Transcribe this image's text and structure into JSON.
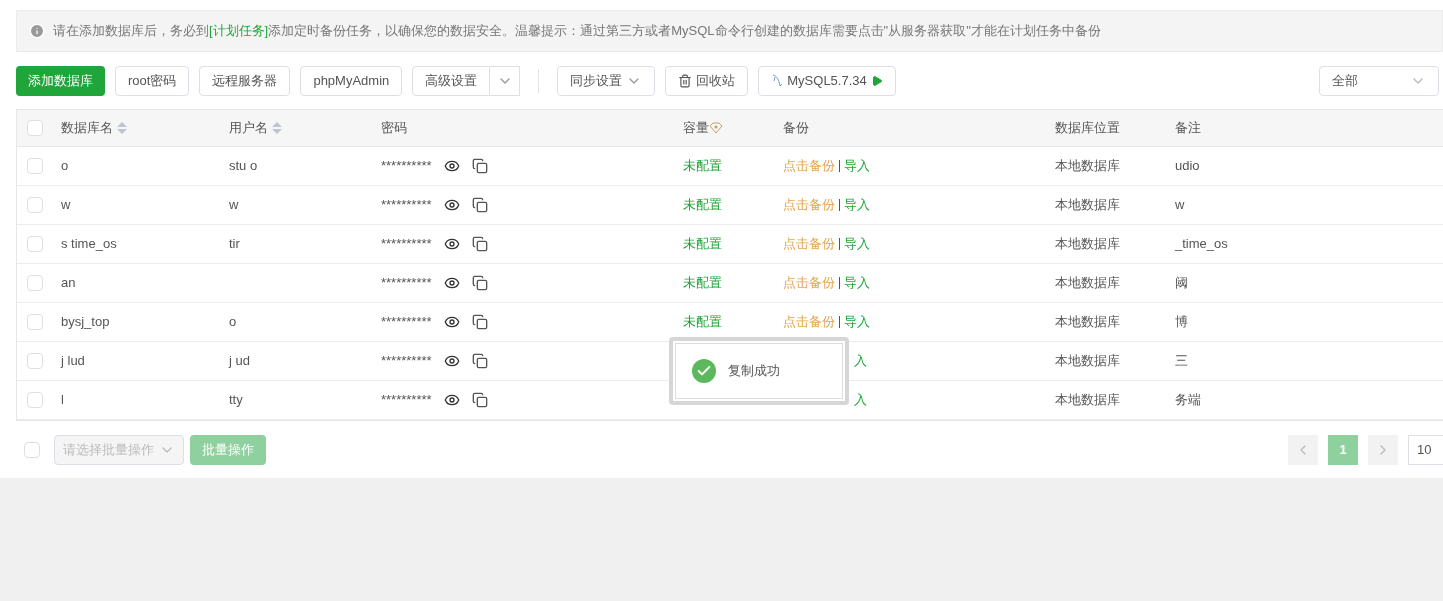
{
  "notice": {
    "text": "请在添加数据库后，务必到",
    "link": "[计划任务]",
    "rest": "添加定时备份任务，以确保您的数据安全。温馨提示：通过第三方或者MySQL命令行创建的数据库需要点击\"从服务器获取\"才能在计划任务中备份"
  },
  "toolbar": {
    "add": "添加数据库",
    "root": "root密码",
    "remote": "远程服务器",
    "pma": "phpMyAdmin",
    "advanced": "高级设置",
    "sync": "同步设置",
    "recycle": "回收站",
    "mysql": "MySQL5.7.34",
    "filter": "全部"
  },
  "table": {
    "all_checked": false,
    "columns": [
      {
        "label": "数据库名",
        "sortable": true
      },
      {
        "label": "用户名",
        "sortable": true
      },
      {
        "label": "密码",
        "sortable": false
      },
      {
        "label": "容量",
        "sortable": false
      },
      {
        "label": "备份",
        "sortable": false
      },
      {
        "label": "数据库位置",
        "sortable": false
      },
      {
        "label": "备注",
        "sortable": false
      }
    ],
    "rows": [
      {
        "checked": false,
        "name": "o",
        "user": "stu o",
        "password": "**********",
        "capacity": "未配置",
        "backup": "点击备份",
        "import": "导入",
        "location": "本地数据库",
        "note": "udio"
      },
      {
        "checked": false,
        "name": "w",
        "user": "w",
        "password": "**********",
        "capacity": "未配置",
        "backup": "点击备份",
        "import": "导入",
        "location": "本地数据库",
        "note": "w"
      },
      {
        "checked": false,
        "name": "s time_os",
        "user": "tir",
        "password": "**********",
        "capacity": "未配置",
        "backup": "点击备份",
        "import": "导入",
        "location": "本地数据库",
        "note": "_time_os"
      },
      {
        "checked": false,
        "name": "an",
        "password": "**********",
        "capacity": "未配置",
        "backup": "点击备份",
        "import": "导入",
        "location": "本地数据库",
        "note": "阈"
      },
      {
        "checked": false,
        "name": "bysj_top",
        "user": "o",
        "password": "**********",
        "capacity": "未配置",
        "backup": "点击备份",
        "import": "导入",
        "location": "本地数据库",
        "note": "博"
      },
      {
        "checked": false,
        "name": "j lud",
        "user": "j ud",
        "password": "**********",
        "import": "入",
        "location": "本地数据库",
        "note": "三"
      },
      {
        "checked": false,
        "name": "l",
        "user": "tty",
        "password": "**********",
        "import": "入",
        "location": "本地数据库",
        "note": "务端"
      }
    ]
  },
  "footer": {
    "select_all_checked": false,
    "batch_placeholder": "请选择批量操作",
    "batch_button": "批量操作",
    "pages": [
      {
        "label": "1",
        "selected": true
      }
    ],
    "page_size": "10"
  },
  "toast": {
    "text": "复制成功"
  }
}
